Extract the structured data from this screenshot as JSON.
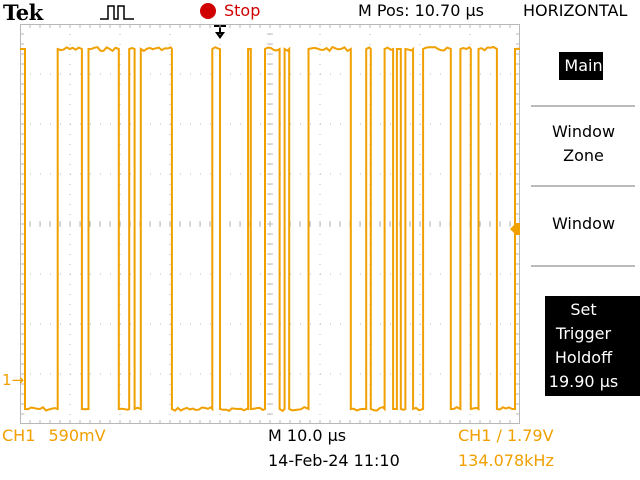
{
  "header": {
    "brand": "Tek",
    "run_state": "Stop",
    "position_readout": "M Pos: 10.70 µs",
    "menu_title": "HORIZONTAL"
  },
  "menu": {
    "main": "Main",
    "window_zone_line1": "Window",
    "window_zone_line2": "Zone",
    "window": "Window",
    "holdoff_line1": "Set",
    "holdoff_line2": "Trigger",
    "holdoff_line3": "Holdoff",
    "holdoff_value": "19.90 µs"
  },
  "status": {
    "ch1_scale": "CH1  590mV",
    "timebase": "M 10.0 µs",
    "datetime": "14-Feb-24 11:10",
    "trigger": "CH1 ∕ 1.79V",
    "frequency": "134.078kHz"
  },
  "markers": {
    "ch1_ground": "1"
  },
  "colors": {
    "ch1": "#f0a000",
    "run_state": "#d00000",
    "graticule": "#b8b8b8",
    "background": "#ffffff"
  },
  "waveform": {
    "low_level_div": -3.7,
    "high_level_div": 3.5,
    "start_state": "high",
    "edge_times_div": [
      0.13,
      0.98,
      1.61,
      1.78,
      2.57,
      2.84,
      2.98,
      3.14,
      3.95,
      5.0,
      5.2,
      5.93,
      6.0,
      6.37,
      6.75,
      6.88,
      7.0,
      7.5,
      8.6,
      9.0,
      9.12,
      9.48,
      9.7,
      9.8,
      9.9,
      10.02,
      10.22,
      10.48,
      11.2,
      11.45,
      11.72,
      11.92,
      12.4,
      12.87
    ]
  }
}
